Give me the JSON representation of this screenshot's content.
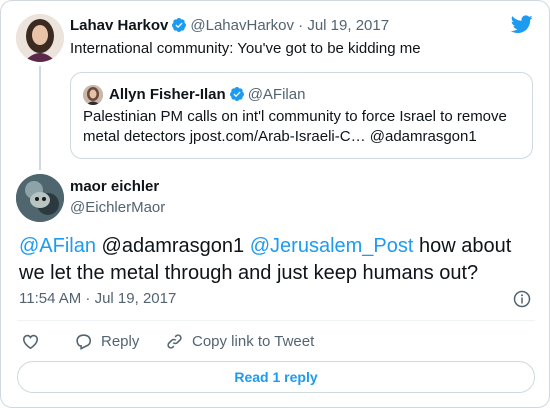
{
  "colors": {
    "accent": "#1d9bf0",
    "muted": "#536471",
    "border": "#cfd9de"
  },
  "original": {
    "author_name": "Lahav Harkov",
    "handle_date": "@LahavHarkov · Jul 19, 2017",
    "text": "International community: You've got to be kidding me"
  },
  "quoted": {
    "author_name": "Allyn Fisher-Ilan",
    "handle": "@AFilan",
    "text": "Palestinian PM calls on int'l community to force Israel to remove metal detectors jpost.com/Arab-Israeli-C… @adamrasgon1"
  },
  "reply": {
    "author_name": "maor eichler",
    "handle": "@EichlerMaor",
    "mention1": "@AFilan",
    "mention2": " @adamrasgon1 ",
    "mention3": "@Jerusalem_Post",
    "body": " how about we let the metal through and just keep humans out?",
    "timestamp": "11:54 AM · Jul 19, 2017"
  },
  "actions": {
    "reply_label": "Reply",
    "copy_label": "Copy link to Tweet",
    "read_replies": "Read 1 reply"
  },
  "icons": [
    "twitter-bird-icon",
    "verified-badge-icon",
    "info-icon",
    "heart-icon",
    "reply-icon",
    "link-icon"
  ]
}
